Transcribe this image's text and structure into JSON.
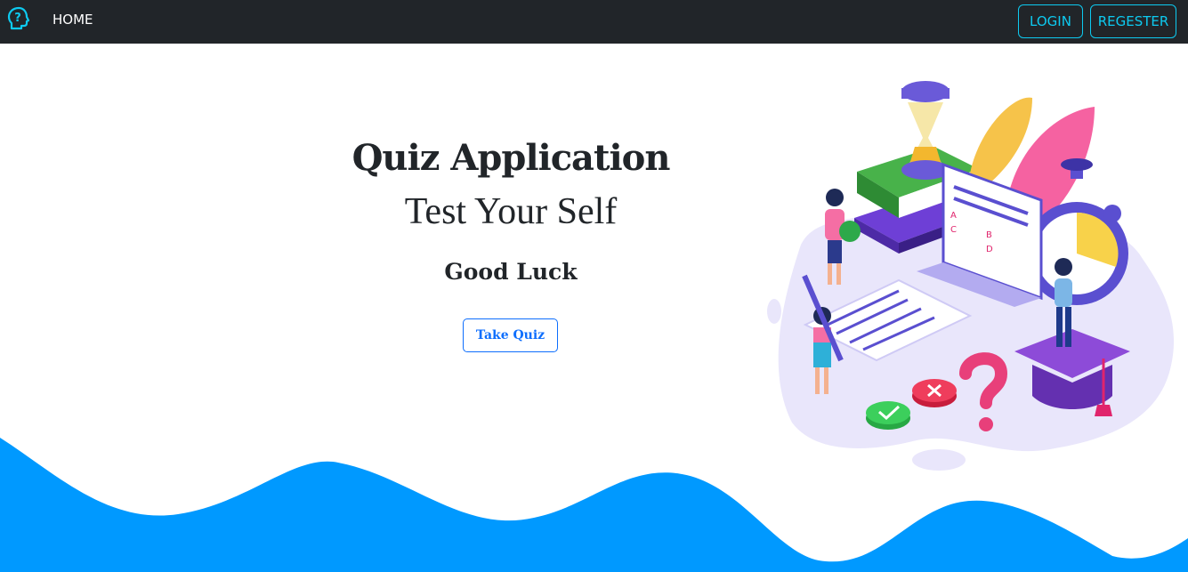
{
  "navbar": {
    "logo_icon": "question-head-icon",
    "home_label": "HOME",
    "login_label": "LOGIN",
    "register_label": "REGESTER",
    "background": "#212529",
    "accent": "#0dcaf0"
  },
  "hero": {
    "title": "Quiz Application",
    "subtitle": "Test Your Self",
    "luck": "Good Luck",
    "button_label": "Take Quiz",
    "button_color": "#0d6efd"
  },
  "illustration": {
    "answer_letters": [
      "A",
      "B",
      "C",
      "D"
    ]
  },
  "wave_color": "#0099ff"
}
